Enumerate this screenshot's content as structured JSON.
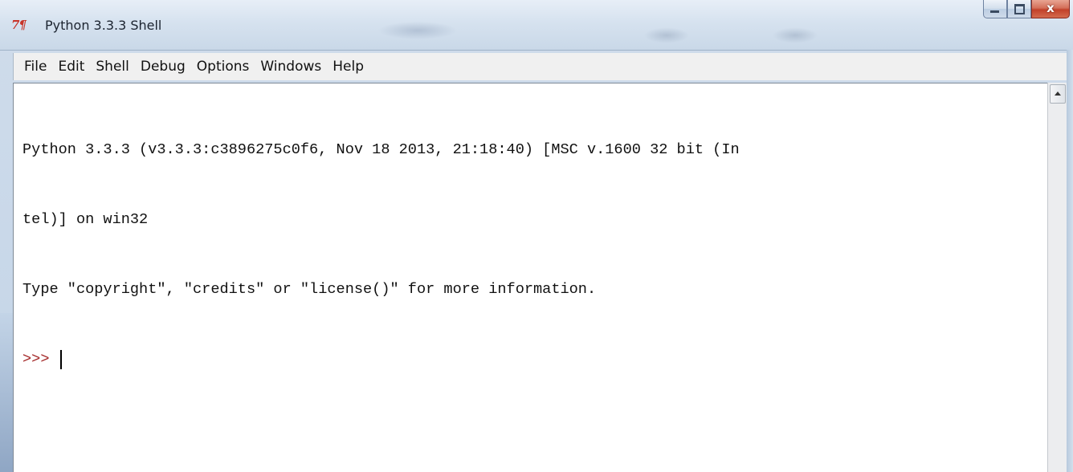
{
  "window": {
    "title": "Python 3.3.3 Shell",
    "app_icon_text": "7¶"
  },
  "controls": {
    "minimize_icon": "minimize-icon",
    "maximize_icon": "maximize-icon",
    "close_label": "x"
  },
  "menu": {
    "items": [
      {
        "label": "File"
      },
      {
        "label": "Edit"
      },
      {
        "label": "Shell"
      },
      {
        "label": "Debug"
      },
      {
        "label": "Options"
      },
      {
        "label": "Windows"
      },
      {
        "label": "Help"
      }
    ]
  },
  "shell": {
    "lines": [
      "Python 3.3.3 (v3.3.3:c3896275c0f6, Nov 18 2013, 21:18:40) [MSC v.1600 32 bit (In",
      "tel)] on win32",
      "Type \"copyright\", \"credits\" or \"license()\" for more information."
    ],
    "prompt": ">>>"
  },
  "colors": {
    "prompt": "#a52a2a",
    "icon_red": "#c8352a",
    "close_button": "#c2412a"
  }
}
